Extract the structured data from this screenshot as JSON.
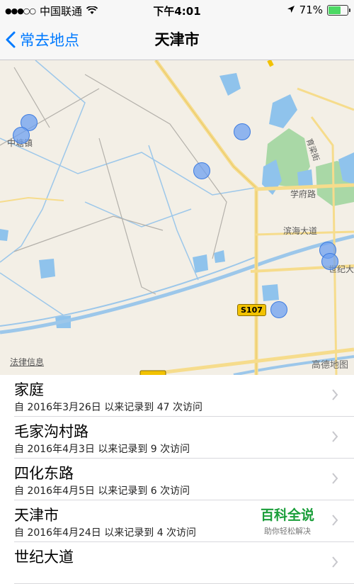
{
  "status_bar": {
    "signal": "●●●○○",
    "carrier": "中国联通",
    "time": "下午4:01",
    "battery_percent_text": "71%",
    "battery_level": 0.71
  },
  "nav": {
    "back_label": "常去地点",
    "title": "天津市"
  },
  "map": {
    "labels": {
      "zhongtang": "中塘镇",
      "yumiao": "育梁街",
      "xuefu": "学府路",
      "binhai": "滨海大道",
      "shiji": "世纪大",
      "s107": "S107"
    },
    "legal": "法律信息",
    "provider": "高德地图"
  },
  "locations": [
    {
      "title": "家庭",
      "subtitle": "自 2016年3月26日 以来记录到 47 次访问"
    },
    {
      "title": "毛家沟村路",
      "subtitle": "自 2016年4月3日 以来记录到 9 次访问"
    },
    {
      "title": "四化东路",
      "subtitle": "自 2016年4月5日 以来记录到 6 次访问"
    },
    {
      "title": "天津市",
      "subtitle": "自 2016年4月24日 以来记录到 4 次访问"
    },
    {
      "title": "世纪大道",
      "subtitle": ""
    }
  ],
  "watermark": {
    "title": "百科全说",
    "subtitle": "助你轻松解决"
  },
  "colors": {
    "accent": "#007aff",
    "marker": "#6ea0f0",
    "water": "#8fc3ec",
    "park": "#a9d8a6",
    "battery": "#4cd964",
    "watermark": "#1a9e3a"
  }
}
